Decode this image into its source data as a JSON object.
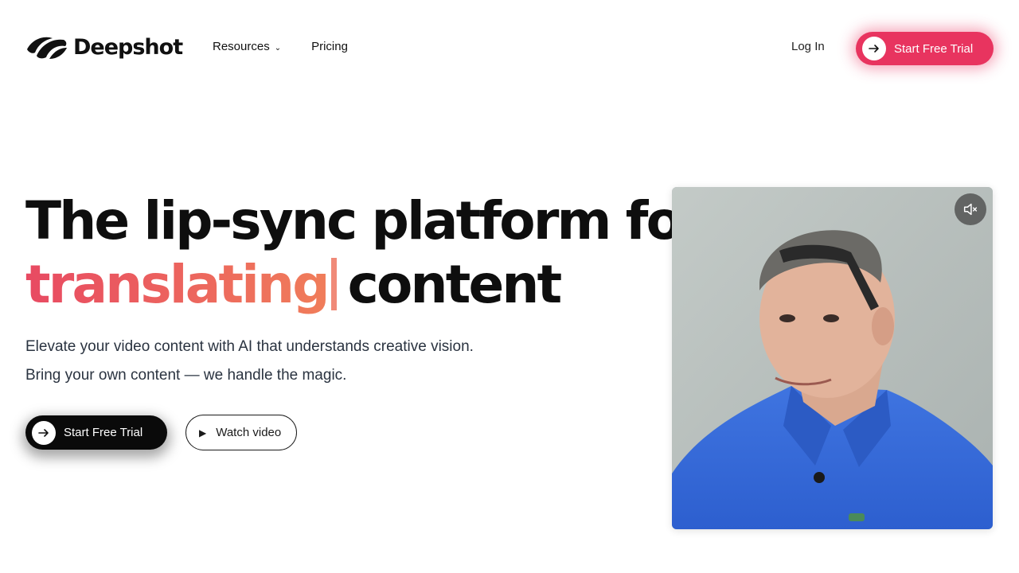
{
  "nav": {
    "brand": "Deepshot",
    "links": [
      {
        "label": "Resources",
        "has_dropdown": true
      },
      {
        "label": "Pricing",
        "has_dropdown": false
      }
    ],
    "login_label": "Log In",
    "cta_label": "Start Free Trial"
  },
  "hero": {
    "headline_line1": "The lip-sync platform for",
    "headline_highlight": "translating",
    "headline_line2_rest": "content",
    "subtitle_line1": "Elevate your video content with AI that understands creative vision.",
    "subtitle_line2": "Bring your own content — we handle the magic.",
    "primary_cta_label": "Start Free Trial",
    "secondary_cta_label": "Watch video"
  },
  "video": {
    "muted": true
  },
  "colors": {
    "accent_pink": "#e8345f",
    "gradient_start": "#e84a62",
    "gradient_end": "#f07d5a",
    "text_dark": "#0e0e0e"
  }
}
